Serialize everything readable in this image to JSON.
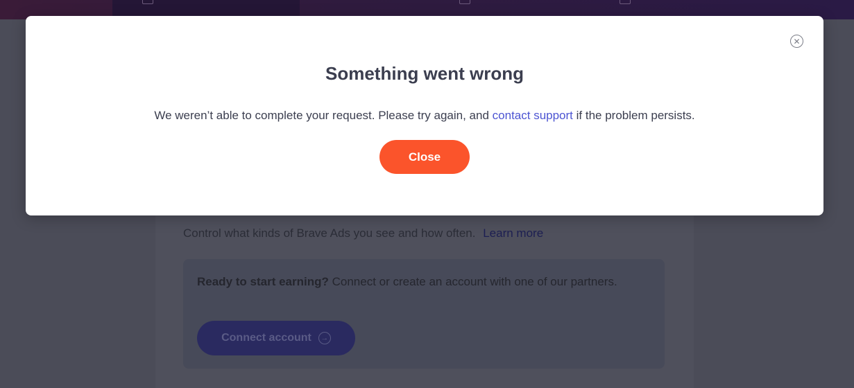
{
  "background": {
    "ads_description": "Control what kinds of Brave Ads you see and how often.",
    "learn_more_link": "Learn more",
    "earn_card": {
      "heading": "Ready to start earning?",
      "body": "Connect or create an account with one of our partners.",
      "connect_button": "Connect account",
      "connect_icon": "arrow-right-circle-icon"
    }
  },
  "modal": {
    "title": "Something went wrong",
    "message_before_link": "We weren’t able to complete your request. Please try again, and",
    "support_link": "contact support",
    "message_after_link": "if the problem persists.",
    "close_button": "Close",
    "close_icon": "close-circle-icon"
  },
  "colors": {
    "accent": "#fb542b",
    "link": "#4c54d2",
    "text": "#3b3e4f"
  }
}
